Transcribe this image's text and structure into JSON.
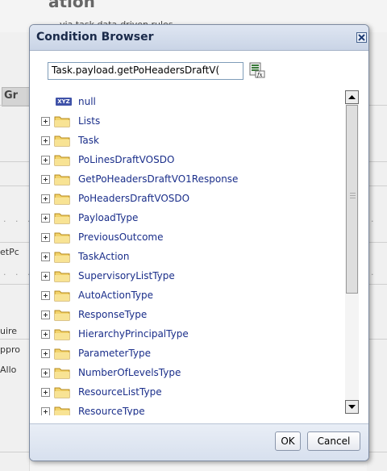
{
  "background": {
    "title_fragment": "ation",
    "subtitle_fragment": "via task data-driven rules",
    "tab_fragment": "Gr",
    "left_labels": [
      "etPc",
      "uire",
      "ppro",
      "Allo"
    ]
  },
  "dialog": {
    "title": "Condition Browser",
    "expression_value": "Task.payload.getPoHeadersDraftV(",
    "tree_items": [
      {
        "label": "null",
        "type": "value"
      },
      {
        "label": "Lists",
        "type": "folder"
      },
      {
        "label": "Task",
        "type": "folder"
      },
      {
        "label": "PoLinesDraftVOSDO",
        "type": "folder"
      },
      {
        "label": "GetPoHeadersDraftVO1Response",
        "type": "folder"
      },
      {
        "label": "PoHeadersDraftVOSDO",
        "type": "folder"
      },
      {
        "label": "PayloadType",
        "type": "folder"
      },
      {
        "label": "PreviousOutcome",
        "type": "folder"
      },
      {
        "label": "TaskAction",
        "type": "folder"
      },
      {
        "label": "SupervisoryListType",
        "type": "folder"
      },
      {
        "label": "AutoActionType",
        "type": "folder"
      },
      {
        "label": "ResponseType",
        "type": "folder"
      },
      {
        "label": "HierarchyPrincipalType",
        "type": "folder"
      },
      {
        "label": "ParameterType",
        "type": "folder"
      },
      {
        "label": "NumberOfLevelsType",
        "type": "folder"
      },
      {
        "label": "ResourceListType",
        "type": "folder"
      },
      {
        "label": "ResourceType",
        "type": "folder"
      }
    ],
    "value_icon_text": "XYZ",
    "ok_label": "OK",
    "cancel_label": "Cancel"
  },
  "colors": {
    "item_text": "#1a2e8a",
    "folder": "#f2d36b",
    "titlebar": "#c9d4e6"
  }
}
